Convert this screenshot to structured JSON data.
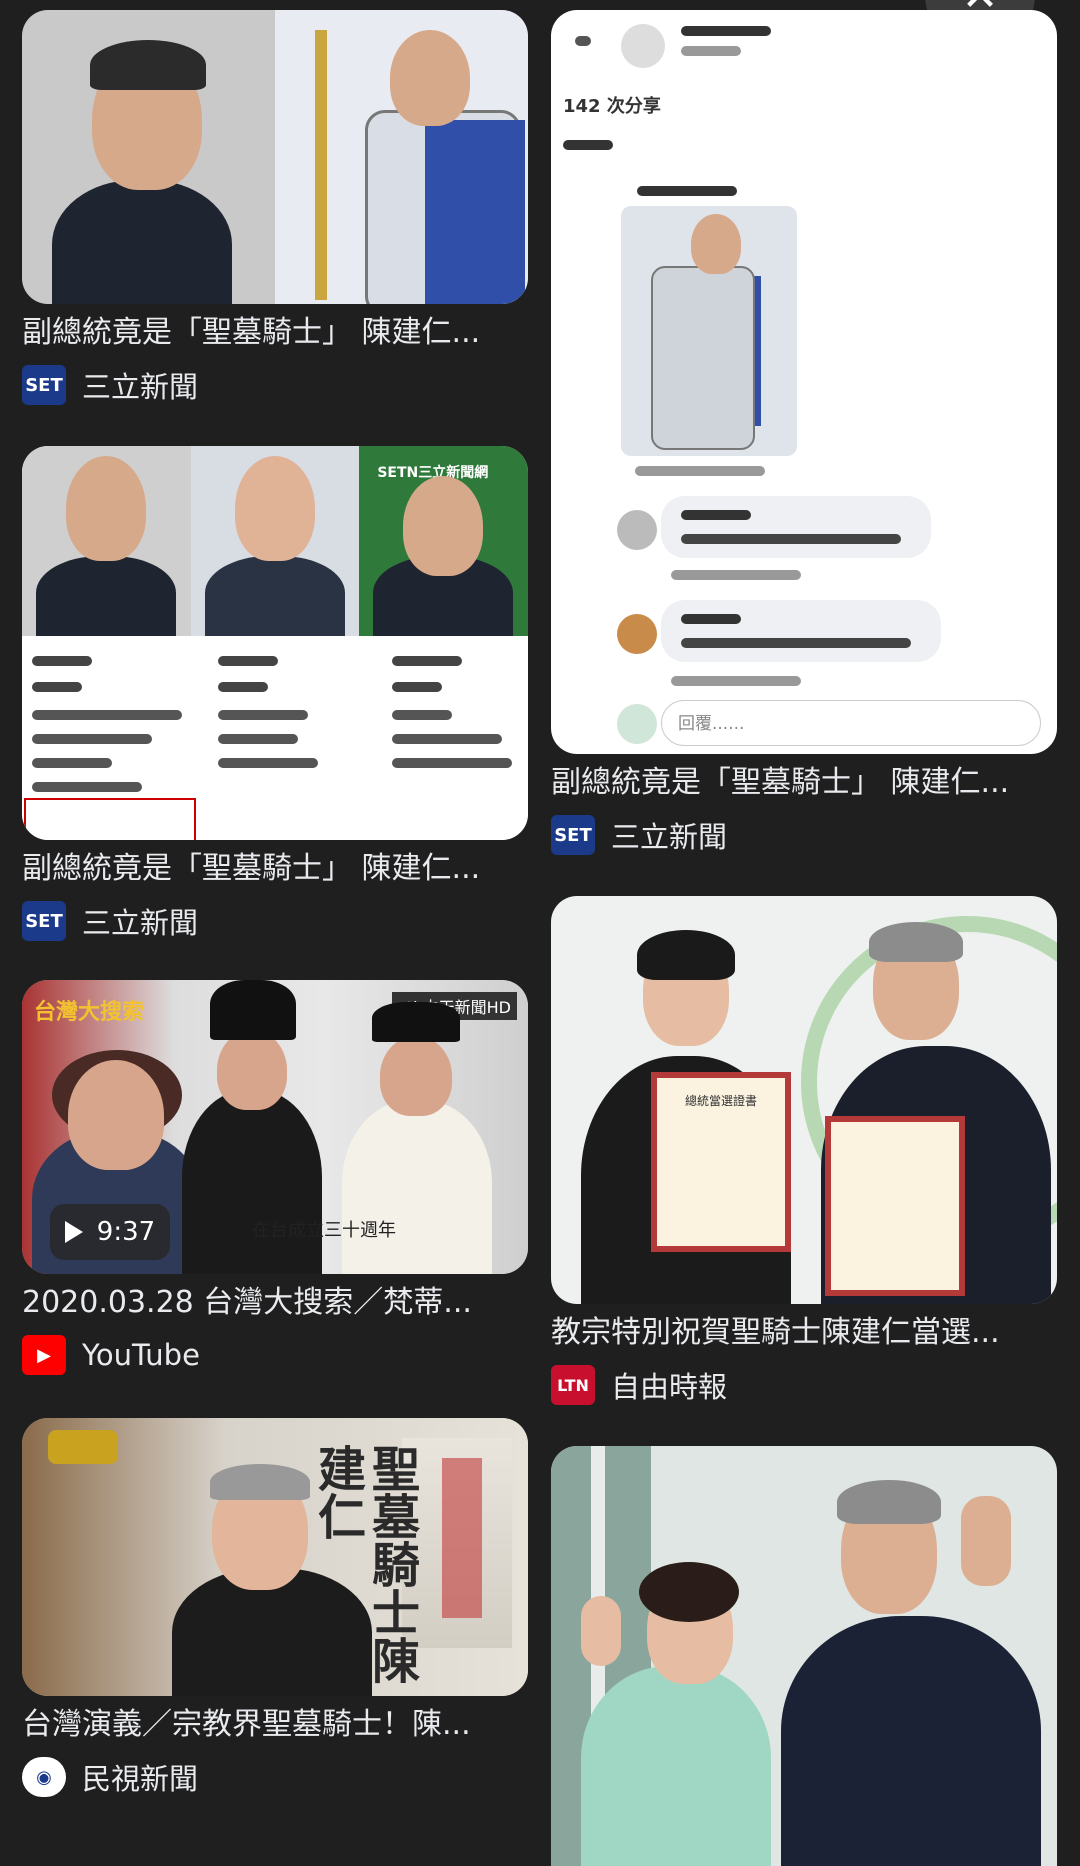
{
  "close_button": {
    "icon": "close-icon",
    "glyph": "✕"
  },
  "results": [
    {
      "caption": "副總統竟是「聖墓騎士」 陳建仁...",
      "source": "三立新聞",
      "favicon_text": "SET",
      "favicon_color": "#1b3a8a"
    },
    {
      "caption": "副總統竟是「聖墓騎士」 陳建仁...",
      "source": "三立新聞",
      "favicon_text": "SET",
      "favicon_color": "#1b3a8a"
    },
    {
      "caption": "2020.03.28 台灣大搜索／梵蒂...",
      "source": "YouTube",
      "favicon_text": "▶",
      "favicon_color": "#ff0000",
      "duration": "9:37"
    },
    {
      "caption": "台灣演義／宗教界聖墓騎士！陳...",
      "source": "民視新聞",
      "favicon_text": "◉",
      "favicon_color": "#ffffff"
    },
    {
      "caption": "副總統竟是「聖墓騎士」 陳建仁...",
      "source": "三立新聞",
      "favicon_text": "SET",
      "favicon_color": "#1b3a8a"
    },
    {
      "caption": "教宗特別祝賀聖騎士陳建仁當選...",
      "source": "自由時報",
      "favicon_text": "LTN",
      "favicon_color": "#c8102e"
    },
    {
      "caption": "",
      "source": ""
    }
  ],
  "thumb_text": {
    "setn_logo": "SETN三立新聞網",
    "fb_shares": "142 次分享",
    "fb_reply": "回覆......",
    "tv_show": "台灣大搜索",
    "tv_channel": "ctl 中天新聞HD",
    "tv_subtitle": "在台成立三十週年",
    "drama_title": "聖墓騎士陳建仁",
    "cert_title": "總統當選證書"
  }
}
